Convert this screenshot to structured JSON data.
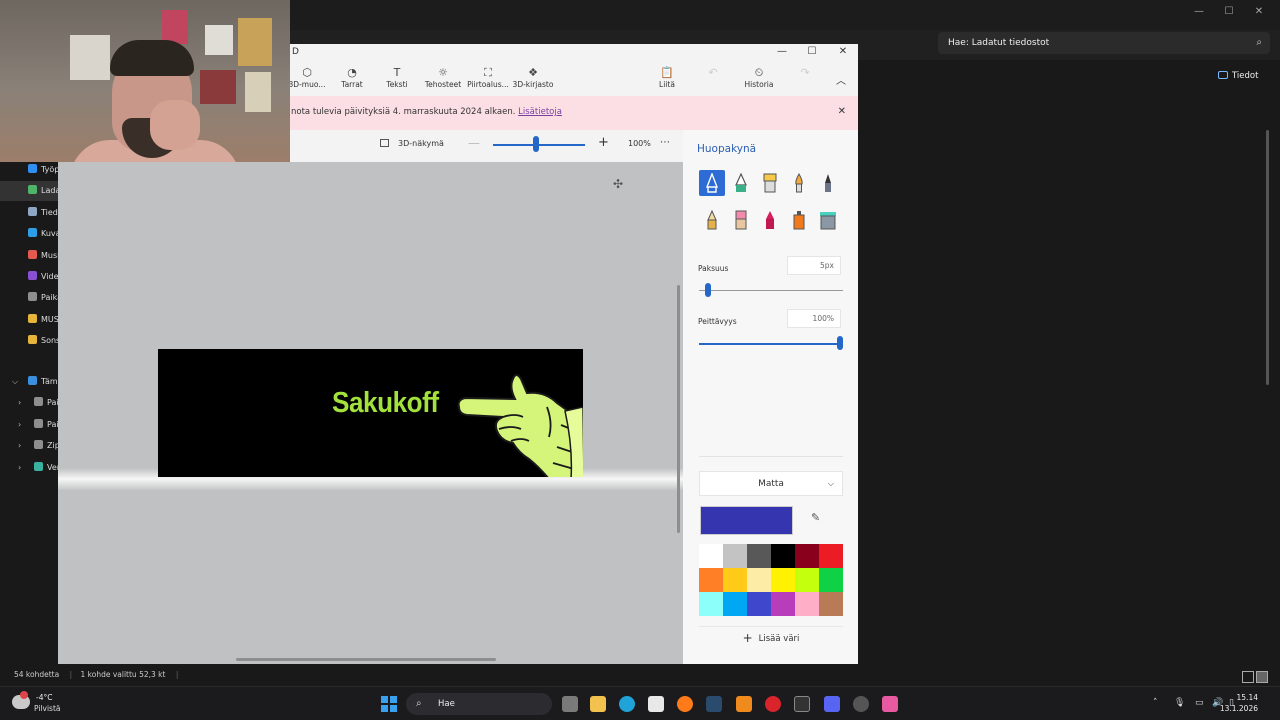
{
  "explorer": {
    "search_placeholder": "Hae: Ladatut tiedostot",
    "details_label": "Tiedot",
    "sidebar": [
      {
        "label": "Työpöytä",
        "color": "#2f8ff2",
        "selected": false
      },
      {
        "label": "Ladatut tiedostot",
        "color": "#4fb46a",
        "selected": true
      },
      {
        "label": "Tiedostot",
        "color": "#8fa6c4",
        "selected": false
      },
      {
        "label": "Kuvat",
        "color": "#2e9fe6",
        "selected": false
      },
      {
        "label": "Musiikki",
        "color": "#e45a4e",
        "selected": false
      },
      {
        "label": "Videot",
        "color": "#8a4fd2",
        "selected": false
      },
      {
        "label": "Paikallinen levy",
        "color": "#8e8e8e",
        "selected": false
      },
      {
        "label": "MUSIIKKI",
        "color": "#e6b43a",
        "selected": false
      },
      {
        "label": "Sonsi",
        "color": "#e6b43a",
        "selected": false
      }
    ],
    "tree": [
      {
        "label": "Tämä tietokone",
        "color": "#3a8fe0"
      },
      {
        "label": "Paikallinen levy (C:)",
        "color": "#8e8e8e"
      },
      {
        "label": "Paikallinen levy (D:)",
        "color": "#8e8e8e"
      },
      {
        "label": "Zip",
        "color": "#8e8e8e"
      },
      {
        "label": "Verkko",
        "color": "#3ab0a0"
      }
    ],
    "status_count": "54 kohdetta",
    "status_selected": "1 kohde valittu 52,3 kt"
  },
  "paint": {
    "title_fragment": "D",
    "toolbar": [
      {
        "label": "3D-muo...",
        "icon": "cube-icon",
        "glyph": "⬡",
        "enabled": true
      },
      {
        "label": "Tarrat",
        "icon": "sticker-icon",
        "glyph": "◔",
        "enabled": true
      },
      {
        "label": "Teksti",
        "icon": "text-icon",
        "glyph": "T",
        "enabled": true
      },
      {
        "label": "Tehosteet",
        "icon": "effects-icon",
        "glyph": "☼",
        "enabled": true
      },
      {
        "label": "Piirtoalus...",
        "icon": "canvas-icon",
        "glyph": "⛶",
        "enabled": true
      },
      {
        "label": "3D-kirjasto",
        "icon": "library-icon",
        "glyph": "❖",
        "enabled": true
      },
      {
        "label": "Liitä",
        "icon": "paste-icon",
        "glyph": "📋",
        "enabled": true
      },
      {
        "label": "Kumoa",
        "icon": "undo-icon",
        "glyph": "↶",
        "enabled": false
      },
      {
        "label": "Historia",
        "icon": "history-icon",
        "glyph": "⏲",
        "enabled": true
      },
      {
        "label": "Tee uudelleen",
        "icon": "redo-icon",
        "glyph": "↷",
        "enabled": false
      }
    ],
    "notice_text": "nota tulevia päivityksiä 4. marraskuuta 2024 alkaen. ",
    "notice_link": "Lisätietoja",
    "view_3d_label": "3D-näkymä",
    "zoom": "100%",
    "zoom_fraction": 0.47,
    "banner_text": "Sakukoff",
    "panel": {
      "title": "Huopakynä",
      "thickness_label": "Paksuus",
      "thickness_value": "5px",
      "thickness_fraction": 0.03,
      "opacity_label": "Peittävyys",
      "opacity_value": "100%",
      "opacity_fraction": 1.0,
      "finish": "Matta",
      "current_color": "#3535b0",
      "palette": [
        "#ffffff",
        "#c3c3c3",
        "#585858",
        "#000000",
        "#88001b",
        "#ec1c24",
        "#ff7f27",
        "#ffca18",
        "#fdeca6",
        "#fff200",
        "#c4ff0e",
        "#0ed145",
        "#8cfffb",
        "#00a8f3",
        "#3f48cc",
        "#b83dba",
        "#ffaec8",
        "#b97a56"
      ],
      "add_color": "Lisää väri"
    }
  },
  "taskbar": {
    "temperature": "-4°C",
    "condition": "Pilvistä",
    "search": "Hae",
    "time": "15.14",
    "date": "13.1.2026"
  }
}
